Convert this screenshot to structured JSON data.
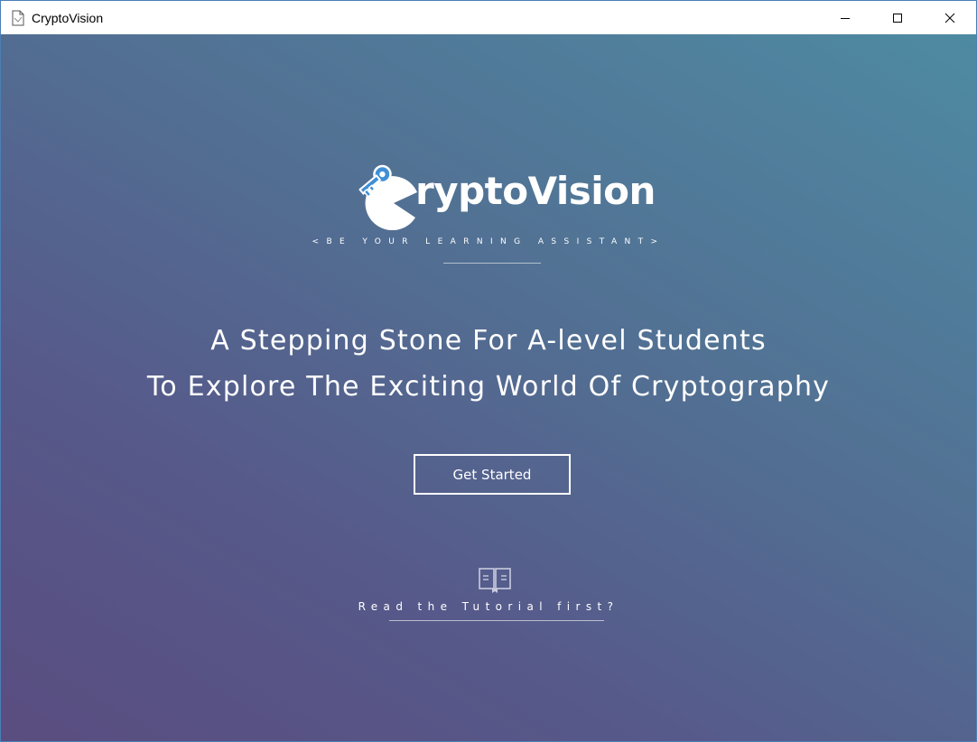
{
  "window": {
    "title": "CryptoVision",
    "icons": {
      "app": "document-icon",
      "minimize": "minimize-icon",
      "maximize": "maximize-icon",
      "close": "close-icon"
    }
  },
  "logo": {
    "text": "ryptoVision",
    "full_name": "CryptoVision",
    "icon": "key-chomper-logo"
  },
  "tagline": "<BE YOUR LEARNING ASSISTANT>",
  "headline": {
    "line1": "A Stepping Stone For A-level Students",
    "line2": "To Explore The Exciting World Of Cryptography"
  },
  "cta": {
    "label": "Get Started"
  },
  "tutorial": {
    "icon": "book-icon",
    "label": "Read the Tutorial first?"
  },
  "colors": {
    "gradient_start": "#5a4d80",
    "gradient_end": "#4e8aa2",
    "key_blue": "#3f8fd6",
    "text": "#ffffff"
  }
}
